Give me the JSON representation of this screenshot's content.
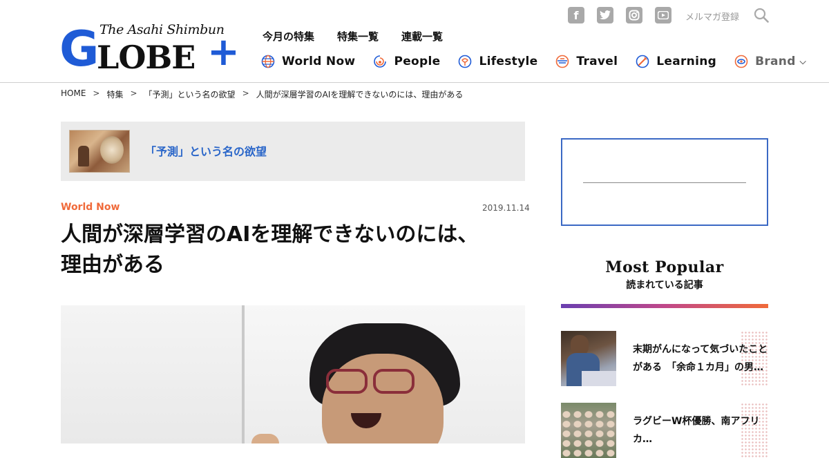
{
  "header": {
    "logo": {
      "brand_line": "The Asahi Shimbun",
      "g": "G",
      "lobe": "LOBE",
      "plus": "+"
    },
    "top_links": [
      "今月の特集",
      "特集一覧",
      "連載一覧"
    ],
    "social_icons": [
      "facebook-icon",
      "twitter-icon",
      "instagram-icon",
      "youtube-icon"
    ],
    "mailmag_label": "メルマガ登録",
    "categories": [
      {
        "label": "World Now",
        "icon": "globe-icon",
        "color": "#1f5bd6"
      },
      {
        "label": "People",
        "icon": "people-icon",
        "color": "#f06a3a"
      },
      {
        "label": "Lifestyle",
        "icon": "lifestyle-icon",
        "color": "#f06a3a"
      },
      {
        "label": "Travel",
        "icon": "travel-icon",
        "color": "#f06a3a"
      },
      {
        "label": "Learning",
        "icon": "learning-icon",
        "color": "#f06a3a"
      },
      {
        "label": "Brand",
        "icon": "brand-icon",
        "color": "#f06a3a"
      }
    ]
  },
  "breadcrumb": {
    "items": [
      "HOME",
      "特集",
      "「予測」という名の欲望",
      "人間が深層学習のAIを理解できないのには、理由がある"
    ],
    "separator": ">"
  },
  "feature": {
    "title": "「予測」という名の欲望"
  },
  "article": {
    "category": "World Now",
    "date": "2019.11.14",
    "title_line1": "人間が深層学習のAIを理解できないのには、",
    "title_line2": "理由がある"
  },
  "sidebar": {
    "popular_en": "Most Popular",
    "popular_ja": "読まれている記事",
    "items": [
      {
        "title": "末期がんになって気づいたことがある　「余命１カ月」の男…"
      },
      {
        "title": "ラグビーW杯優勝、南アフリカ…"
      }
    ]
  },
  "colors": {
    "brand_blue": "#1f5bd6",
    "accent_orange": "#f06a3a",
    "link_blue": "#2a66c9"
  }
}
